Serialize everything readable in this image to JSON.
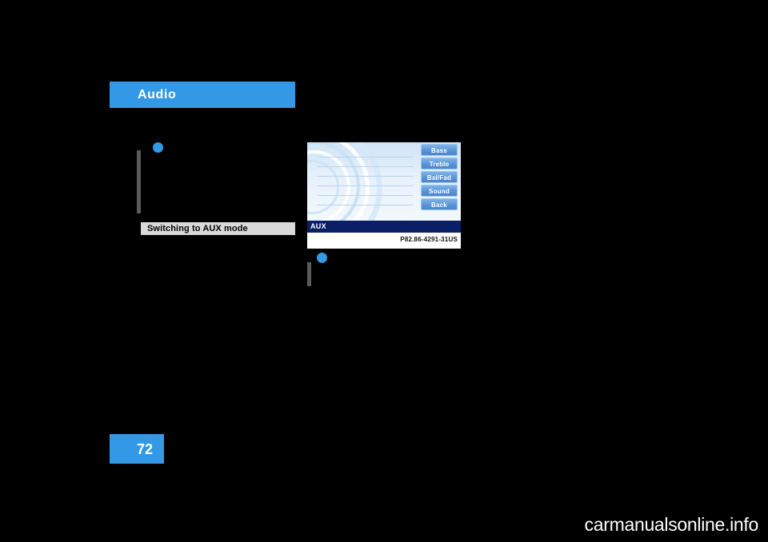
{
  "page": {
    "section_title": "Audio",
    "page_number": "72",
    "watermark": "carmanualsonline.info"
  },
  "left_column": {
    "bullet_icon": "filled-circle-bullet",
    "subheading": "Switching to AUX mode"
  },
  "right_column": {
    "bullet_icon": "filled-circle-bullet",
    "figure": {
      "status_label": "AUX",
      "figure_code": "P82.86-4291-31US",
      "buttons": [
        "Bass",
        "Treble",
        "Bal/Fad",
        "Sound",
        "Back"
      ]
    }
  },
  "colors": {
    "accent": "#3399e6",
    "page_background": "#000000",
    "subheading_bar": "#d9d9d9",
    "status_bar": "#0a1f66"
  }
}
